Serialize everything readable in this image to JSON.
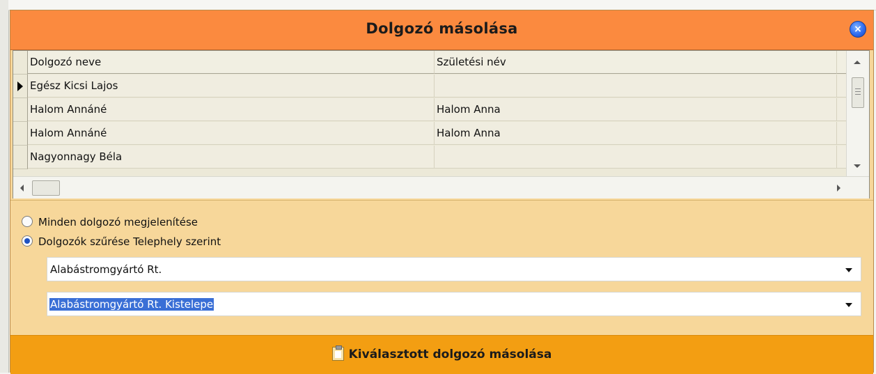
{
  "dialog": {
    "title": "Dolgozó másolása"
  },
  "grid": {
    "columns": [
      "Dolgozó neve",
      "Születési név"
    ],
    "rows": [
      {
        "name": "Egész Kicsi Lajos",
        "birth_name": "",
        "current": true
      },
      {
        "name": "Halom Annáné",
        "birth_name": "Halom Anna",
        "current": false
      },
      {
        "name": "Halom Annáné",
        "birth_name": "Halom Anna",
        "current": false
      },
      {
        "name": "Nagyonnagy Béla",
        "birth_name": "",
        "current": false
      }
    ]
  },
  "filters": {
    "show_all_label": "Minden dolgozó megjelenítése",
    "filter_site_label": "Dolgozók szűrése Telephely szerint",
    "selected_option": "filter_site",
    "company_value": "Alabástromgyártó Rt.",
    "site_value": "Alabástromgyártó Rt. Kistelepe"
  },
  "actions": {
    "copy_label": "Kiválasztott dolgozó másolása"
  },
  "icons": {
    "close": "close-circle-icon",
    "copy": "clipboard-icon"
  },
  "colors": {
    "titlebar": "#fb8a3f",
    "panel": "#f7d79a",
    "button": "#f39e12",
    "selection": "#3a6fd6"
  }
}
